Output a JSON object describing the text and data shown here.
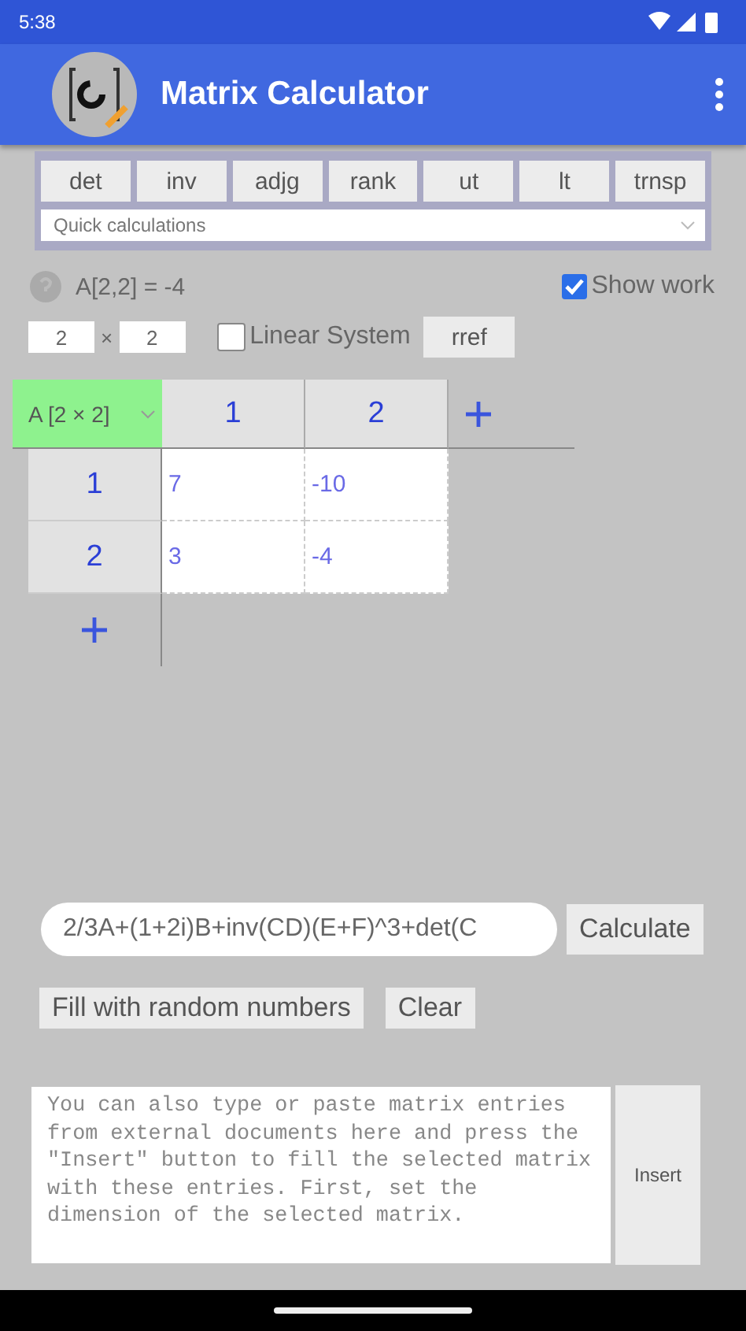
{
  "status_bar": {
    "time": "5:38"
  },
  "app_bar": {
    "title": "Matrix Calculator"
  },
  "functions": [
    "det",
    "inv",
    "adjg",
    "rank",
    "ut",
    "lt",
    "trnsp"
  ],
  "quick_calculations": {
    "placeholder": "Quick calculations"
  },
  "result": {
    "text": "A[2,2] = -4"
  },
  "show_work": {
    "label": "Show work",
    "checked": true
  },
  "dimensions": {
    "rows": "2",
    "times": "×",
    "columns": "2"
  },
  "linear_system": {
    "label": "Linear System",
    "checked": false
  },
  "rref_button": "rref",
  "matrix": {
    "name": "A [2 × 2]",
    "selected": true,
    "columns": [
      "1",
      "2"
    ],
    "rows": [
      {
        "label": "1",
        "cells": [
          "7",
          "-10"
        ]
      },
      {
        "label": "2",
        "cells": [
          "3",
          "-4"
        ]
      }
    ]
  },
  "expression": {
    "value": "2/3A+(1+2i)B+inv(CD)(E+F)^3+det(C"
  },
  "calculate_button": "Calculate",
  "fill_button": "Fill with random numbers",
  "clear_button": "Clear",
  "paste_area": {
    "placeholder": "You can also type or paste matrix entries from external documents here and press the \"Insert\" button to fill the selected matrix with these entries. First, set the dimension of the selected matrix."
  },
  "insert_button": "Insert"
}
